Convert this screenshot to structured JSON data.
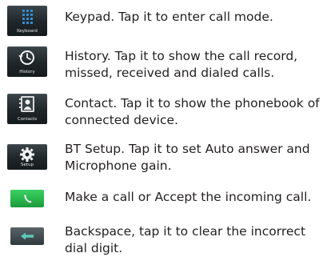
{
  "items": [
    {
      "icon": "keypad-icon",
      "caption": "Keyboard",
      "text": "Keypad. Tap it to enter call mode."
    },
    {
      "icon": "history-icon",
      "caption": "History",
      "text": "History. Tap it to show the call record, missed, received and dialed calls."
    },
    {
      "icon": "contact-icon",
      "caption": "Contacts",
      "text": "Contact. Tap it to show the phonebook of connected device."
    },
    {
      "icon": "bt-setup-gear-icon",
      "caption": "Setup",
      "text": "BT Setup. Tap it to set Auto answer and Microphone gain."
    },
    {
      "icon": "call-button-phone-icon",
      "caption": "",
      "text": "Make a call or Accept the incoming call."
    },
    {
      "icon": "backspace-arrow-icon",
      "caption": "",
      "text": "Backspace, tap it to clear the incorrect dial digit."
    }
  ],
  "colors": {
    "text": "#231f20",
    "tile_dark": "#1f2629",
    "keypad_blue": "#2f8fd6",
    "call_green": "#26b24a",
    "backspace_teal": "#2f9c94"
  }
}
